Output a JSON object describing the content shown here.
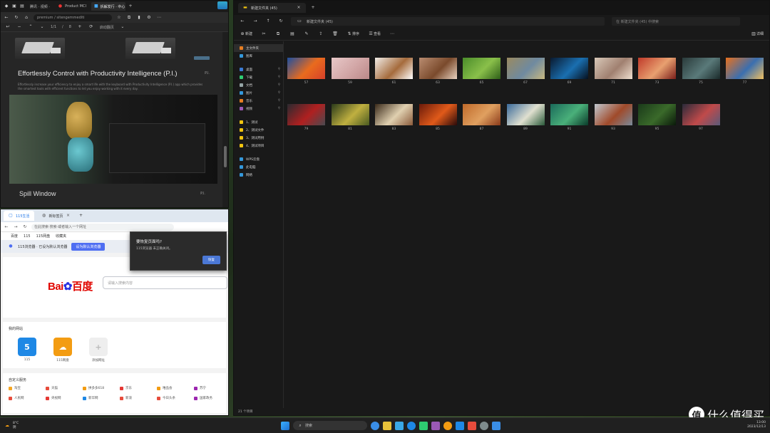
{
  "top_left_browser": {
    "tabs": [
      {
        "label": "腾讯 · 视频 ·"
      },
      {
        "label": "Product MCI"
      },
      {
        "label": "拆解发行 · 中心"
      }
    ],
    "url": "premium / sitengemmediti",
    "find_bar": {
      "count": "1/1",
      "sep": "/",
      "total": "8",
      "label": "启动翻页"
    },
    "headline": "Effortlessly Control with Productivity Intelligence (P.I.)",
    "headline_right": "P.I.",
    "description": "Effortlessly increase your efficiency to enjoy a smart life with the keyboard with Productivity Intelligence (P.I.) app which provides the smartest tools with efficient functions to let you enjoy working with it every day.",
    "subheading": "Spill Window",
    "subheading_right": "P.I."
  },
  "bottom_left_browser": {
    "tabs": [
      {
        "label": "115生活"
      },
      {
        "label": "新标签页"
      }
    ],
    "url": "在此搜索·搜索·或者输入一个网址",
    "bookmarks": [
      "百度",
      "115",
      "115网盘",
      "收藏夹"
    ],
    "banner_text": "115浏览器 · 已设为默认浏览器",
    "banner_button": "设为默认浏览器",
    "logo_text": "Bai",
    "logo_text2": "百度",
    "search_placeholder": "请输入搜索内容",
    "favorites_title": "我的网站",
    "favorites": [
      {
        "label": "115",
        "tile": "5",
        "color": "#1e88e5"
      },
      {
        "label": "115网盘",
        "tile": "☁",
        "color": "#f39c12"
      },
      {
        "label": "添加网址",
        "tile": "+",
        "color": "#eeeeee"
      }
    ],
    "services_title": "自定义服务",
    "services": [
      {
        "label": "淘宝",
        "color": "#f5a623"
      },
      {
        "label": "天猫",
        "color": "#e74c3c"
      },
      {
        "label": "拼多多618",
        "color": "#f39c12"
      },
      {
        "label": "京东",
        "color": "#e53935"
      },
      {
        "label": "唯品会",
        "color": "#f39c12"
      },
      {
        "label": "苏宁",
        "color": "#9c27b0"
      },
      {
        "label": "人民网",
        "color": "#e74c3c"
      },
      {
        "label": "央视网",
        "color": "#e53935"
      },
      {
        "label": "新华网",
        "color": "#1e88e5"
      },
      {
        "label": "新浪",
        "color": "#e74c3c"
      },
      {
        "label": "今日头条",
        "color": "#e74c3c"
      },
      {
        "label": "国家政务",
        "color": "#9c27b0"
      }
    ]
  },
  "popup": {
    "title": "要恢复页面吗?",
    "body": "115浏览器 未正确关闭。",
    "button": "恢复"
  },
  "explorer": {
    "tab_label": "新建文件夹 (45)",
    "breadcrumb": "新建文件夹 (45)",
    "search_placeholder": "在 新建文件夹 (45) 中搜索",
    "commands": {
      "new": "新建",
      "sort": "排序",
      "view": "查看",
      "details": "详细"
    },
    "nav_items": [
      {
        "label": "主文件夹",
        "sel": true,
        "color": "#e67e22",
        "pin": ""
      },
      {
        "label": "图库",
        "sel": false,
        "color": "#3498db",
        "pin": ""
      },
      {
        "label": "桌面",
        "sel": false,
        "color": "#3a7bd5",
        "pin": "⚲"
      },
      {
        "label": "下载",
        "sel": false,
        "color": "#2ecc71",
        "pin": "⚲"
      },
      {
        "label": "文档",
        "sel": false,
        "color": "#95a5a6",
        "pin": "⚲"
      },
      {
        "label": "图片",
        "sel": false,
        "color": "#3498db",
        "pin": "⚲"
      },
      {
        "label": "音乐",
        "sel": false,
        "color": "#e67e22",
        "pin": "⚲"
      },
      {
        "label": "视频",
        "sel": false,
        "color": "#9b59b6",
        "pin": "⚲"
      },
      {
        "label": "1、测试",
        "sel": false,
        "color": "#f1c40f",
        "pin": ""
      },
      {
        "label": "2、测试文件",
        "sel": false,
        "color": "#f1c40f",
        "pin": ""
      },
      {
        "label": "3、测试用例",
        "sel": false,
        "color": "#f1c40f",
        "pin": ""
      },
      {
        "label": "4、测试项目",
        "sel": false,
        "color": "#f1c40f",
        "pin": ""
      },
      {
        "label": "WPS云盘",
        "sel": false,
        "color": "#3498db",
        "pin": ""
      },
      {
        "label": "此电脑",
        "sel": false,
        "color": "#3498db",
        "pin": ""
      },
      {
        "label": "网络",
        "sel": false,
        "color": "#3498db",
        "pin": ""
      }
    ],
    "thumbnails": [
      {
        "label": "57",
        "colors": [
          "#1d4fa0",
          "#e96b1e",
          "#d6402a"
        ]
      },
      {
        "label": "59",
        "colors": [
          "#e8c8c8",
          "#d2a6a6",
          "#b88"
        ]
      },
      {
        "label": "61",
        "colors": [
          "#f1ede8",
          "#a56b3c",
          "#fff"
        ]
      },
      {
        "label": "63",
        "colors": [
          "#b98c70",
          "#7a4a2c",
          "#e8d2c0"
        ]
      },
      {
        "label": "65",
        "colors": [
          "#4a8c2a",
          "#8ac04a",
          "#2e5e18"
        ]
      },
      {
        "label": "67",
        "colors": [
          "#9a8a60",
          "#6f8aa0",
          "#c8b880"
        ]
      },
      {
        "label": "69",
        "colors": [
          "#0a1a30",
          "#1a6fb0",
          "#06101e"
        ]
      },
      {
        "label": "71",
        "colors": [
          "#d8c8b8",
          "#a08070",
          "#f0e0d0"
        ]
      },
      {
        "label": "73",
        "colors": [
          "#c03a2a",
          "#e8a070",
          "#7a1e1a"
        ]
      },
      {
        "label": "75",
        "colors": [
          "#2a3a3a",
          "#5a7a7a",
          "#1a2a2a"
        ]
      },
      {
        "label": "77",
        "colors": [
          "#e8701e",
          "#3a6fb0",
          "#f0c060"
        ]
      },
      {
        "label": "79",
        "colors": [
          "#2a2a30",
          "#b02020",
          "#4a4a50"
        ]
      },
      {
        "label": "81",
        "colors": [
          "#2a3a1a",
          "#c0b040",
          "#4a5a20"
        ]
      },
      {
        "label": "83",
        "colors": [
          "#3a2a1a",
          "#e0d0b0",
          "#8a5a3a"
        ]
      },
      {
        "label": "85",
        "colors": [
          "#6a1a0a",
          "#e05a1a",
          "#2a0a0a"
        ]
      },
      {
        "label": "87",
        "colors": [
          "#c06a2a",
          "#e0a060",
          "#8a3a1a"
        ]
      },
      {
        "label": "89",
        "colors": [
          "#3a6a9a",
          "#e0e0d0",
          "#2a5a3a"
        ]
      },
      {
        "label": "91",
        "colors": [
          "#1a6a5a",
          "#4ab07a",
          "#0a3a2a"
        ]
      },
      {
        "label": "93",
        "colors": [
          "#c0c8d0",
          "#a04a2a",
          "#7a8a9a"
        ]
      },
      {
        "label": "95",
        "colors": [
          "#1a3a1a",
          "#3a6a2a",
          "#0a1a0a"
        ]
      },
      {
        "label": "97",
        "colors": [
          "#2a2a3a",
          "#c04a4a",
          "#5a5a7a"
        ]
      }
    ],
    "status": "21 个项目"
  },
  "taskbar": {
    "weather_temp": "8°C",
    "weather_desc": "阴",
    "search_label": "搜索",
    "icon_colors": [
      "#3a8ee6",
      "#e8c23a",
      "#3aa8e6",
      "#1e88e5",
      "#2ecc71",
      "#9b59b6",
      "#f39c12",
      "#1e88e5",
      "#e74c3c",
      "#7f8c8d",
      "#3a8ee6"
    ],
    "clock_time": "13:00",
    "clock_date": "2023/12/13"
  },
  "watermark": {
    "glyph": "值",
    "text": "什么值得买"
  }
}
